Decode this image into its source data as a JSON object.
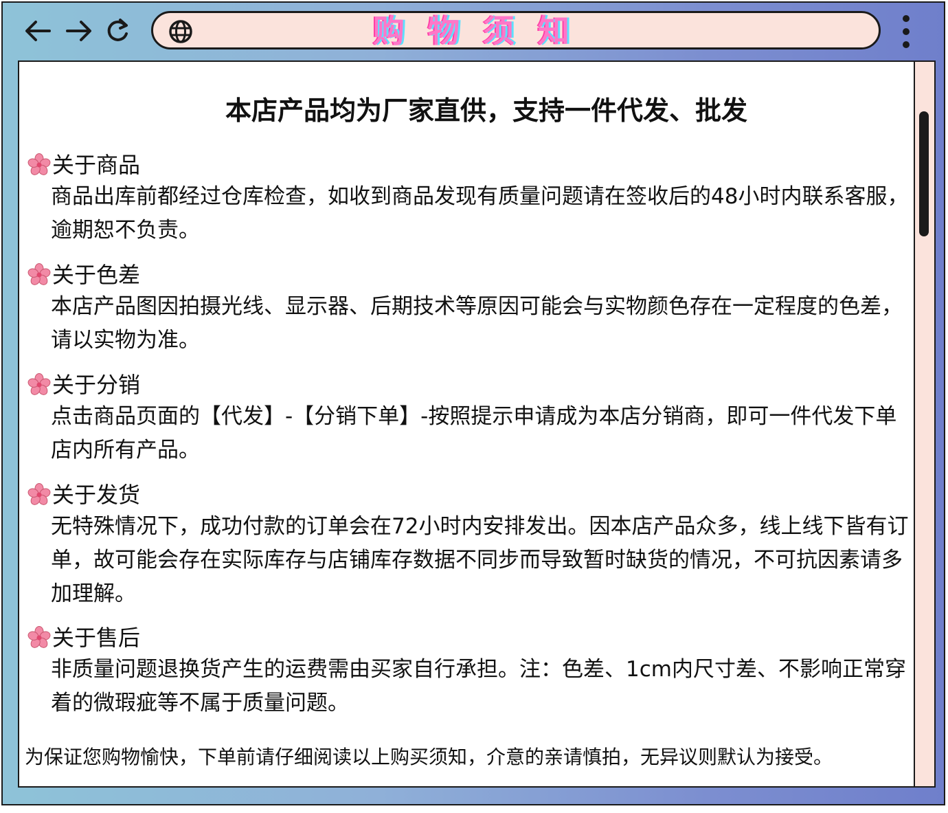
{
  "window": {
    "title": "购物须知"
  },
  "toolbar": {
    "back_icon": "arrow-left-icon",
    "forward_icon": "arrow-right-icon",
    "reload_icon": "reload-icon",
    "address_icon": "globe-icon",
    "menu_icon": "vertical-dots-icon"
  },
  "page": {
    "headline": "本店产品均为厂家直供，支持一件代发、批发",
    "sections": [
      {
        "title": "关于商品",
        "body": "商品出库前都经过仓库检查，如收到商品发现有质量问题请在签收后的48小时内联系客服，逾期恕不负责。"
      },
      {
        "title": "关于色差",
        "body": "本店产品图因拍摄光线、显示器、后期技术等原因可能会与实物颜色存在一定程度的色差，请以实物为准。"
      },
      {
        "title": "关于分销",
        "body": "点击商品页面的【代发】-【分销下单】-按照提示申请成为本店分销商，即可一件代发下单店内所有产品。"
      },
      {
        "title": "关于发货",
        "body": "无特殊情况下，成功付款的订单会在72小时内安排发出。因本店产品众多，线上线下皆有订单，故可能会存在实际库存与店铺库存数据不同步而导致暂时缺货的情况，不可抗因素请多加理解。"
      },
      {
        "title": "关于售后",
        "body": "非质量问题退换货产生的运费需由买家自行承担。注：色差、1cm内尺寸差、不影响正常穿着的微瑕疵等不属于质量问题。"
      }
    ],
    "footer": "为保证您购物愉快，下单前请仔细阅读以上购买须知，介意的亲请慎拍，无异议则默认为接受。",
    "bullet_icon": "flower-icon"
  },
  "colors": {
    "frame_left": "#8ec3d8",
    "frame_right": "#6f7fcb",
    "address_bg": "#fbe3dc",
    "title_pink": "#ff77c8",
    "title_cyan": "#5de0ff",
    "flower_pink": "#f28aa6"
  }
}
